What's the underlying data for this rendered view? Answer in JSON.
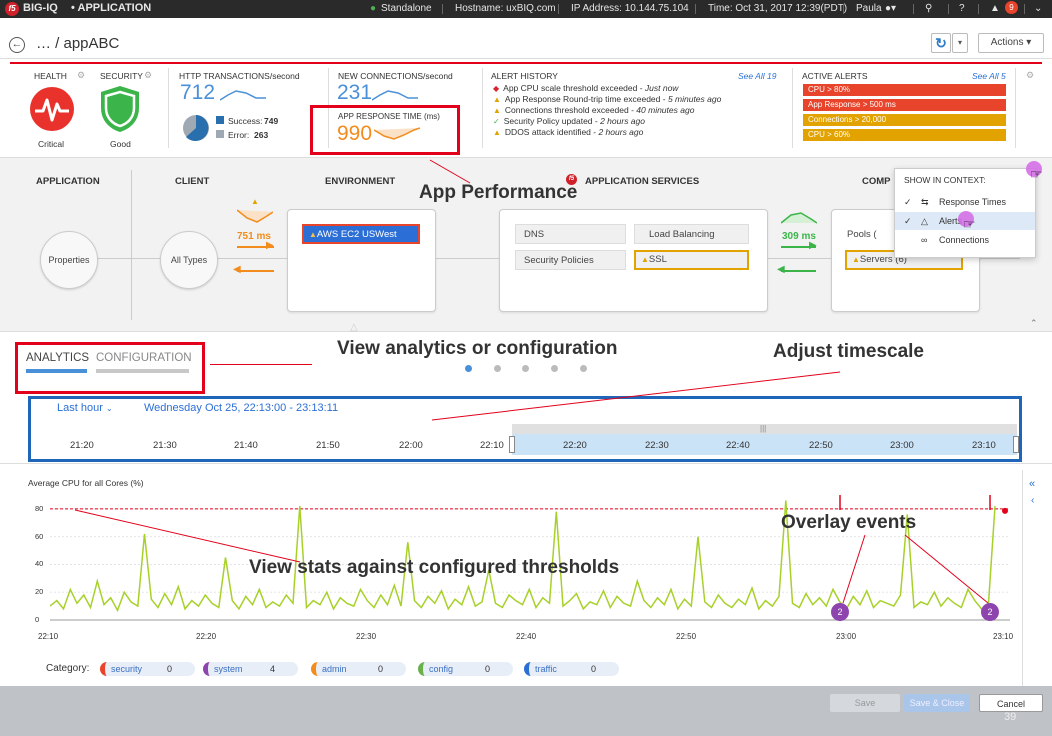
{
  "topbar": {
    "logo_text": "f5",
    "product": "BIG-IQ",
    "module": "• APPLICATION",
    "mode": "Standalone",
    "hostname": "Hostname: uxBIQ.com",
    "ip": "IP Address: 10.144.75.104",
    "time": "Time: Oct 31, 2017 12:39(PDT)",
    "user": "Paula",
    "notifications": "9"
  },
  "header": {
    "breadcrumb": "… / appABC",
    "actions_label": "Actions"
  },
  "dashboard": {
    "health_label": "HEALTH",
    "health_value": "Critical",
    "security_label": "SECURITY",
    "security_value": "Good",
    "http_label": "HTTP TRANSACTIONS/second",
    "http_value": "712",
    "success_label": "Success:",
    "success_value": "749",
    "error_label": "Error:",
    "error_value": "263",
    "conn_label": "NEW CONNECTIONS/second",
    "conn_value": "231",
    "resp_label": "APP RESPONSE TIME (ms)",
    "resp_value": "990",
    "alert_history_label": "ALERT HISTORY",
    "alert_history_link": "See All 19",
    "alert_history": [
      {
        "text": "App CPU scale threshold exceeded - ",
        "time": "Just now",
        "color": "#d9232d"
      },
      {
        "text": "App Response Round-trip time exceeded - ",
        "time": "5 minutes ago",
        "color": "#e2a300"
      },
      {
        "text": "Connections threshold exceeded - ",
        "time": "40 minutes ago",
        "color": "#e2a300"
      },
      {
        "text": "Security Policy updated - ",
        "time": "2 hours ago",
        "color": "#4caf50"
      },
      {
        "text": "DDOS attack identified - ",
        "time": "2 hours ago",
        "color": "#e2a300"
      }
    ],
    "active_alerts_label": "ACTIVE ALERTS",
    "active_alerts_link": "See All 5",
    "active_alerts": [
      {
        "text": "CPU > 80%",
        "color": "#e8442b"
      },
      {
        "text": "App Response > 500 ms",
        "color": "#e8442b"
      },
      {
        "text": "Connections > 20,000",
        "color": "#e2a300"
      },
      {
        "text": "CPU > 60%",
        "color": "#e2a300"
      }
    ]
  },
  "topology": {
    "col_application": "APPLICATION",
    "col_client": "CLIENT",
    "col_environment": "ENVIRONMENT",
    "col_services": "APPLICATION SERVICES",
    "col_comp": "COMP",
    "properties": "Properties",
    "all_types": "All Types",
    "client_latency": "751 ms",
    "env_chip": "AWS EC2 USWest",
    "svc_dns": "DNS",
    "svc_lb": "Load Balancing",
    "svc_sec": "Security Policies",
    "svc_ssl": "SSL",
    "server_latency": "309 ms",
    "pools": "Pools (",
    "servers": "Servers (6)"
  },
  "context_menu": {
    "title": "SHOW IN CONTEXT:",
    "items": [
      "Response Times",
      "Alerts",
      "Connections"
    ]
  },
  "annotations": {
    "app_performance": "App Performance",
    "view_analytics": "View analytics or configuration",
    "adjust_timescale": "Adjust timescale",
    "overlay_events": "Overlay events",
    "view_stats": "View stats against configured thresholds"
  },
  "tabs": {
    "analytics": "ANALYTICS",
    "configuration": "CONFIGURATION"
  },
  "timescale": {
    "range_select": "Last hour",
    "range_text": "Wednesday Oct 25, 22:13:00 - 23:13:11",
    "ticks": [
      "21:20",
      "21:30",
      "21:40",
      "21:50",
      "22:00",
      "22:10",
      "22:20",
      "22:30",
      "22:40",
      "22:50",
      "23:00",
      "23:10"
    ]
  },
  "chart_data": {
    "type": "line",
    "title": "Average CPU for all Cores (%)",
    "ylim": [
      0,
      90
    ],
    "yticks": [
      "0",
      "20",
      "40",
      "60",
      "80"
    ],
    "xticks": [
      "22:10",
      "22:20",
      "22:30",
      "22:40",
      "22:50",
      "23:00",
      "23:10"
    ],
    "threshold": 80,
    "series_color": "#a7d129",
    "values": [
      10,
      14,
      8,
      22,
      12,
      18,
      9,
      28,
      11,
      16,
      7,
      20,
      13,
      10,
      62,
      15,
      9,
      19,
      11,
      24,
      8,
      14,
      10,
      18,
      12,
      9,
      45,
      14,
      8,
      17,
      11,
      22,
      9,
      13,
      10,
      18,
      12,
      82,
      9,
      14,
      11,
      20,
      8,
      16,
      12,
      10,
      22,
      14,
      9,
      18,
      11,
      25,
      10,
      56,
      14,
      9,
      17,
      12,
      21,
      8,
      15,
      11,
      24,
      10,
      13,
      36,
      12,
      9,
      18,
      14,
      11,
      22,
      9,
      16,
      12,
      78,
      10,
      14,
      19,
      8,
      13,
      11,
      21,
      9,
      17,
      12,
      10,
      28,
      14,
      9,
      16,
      11,
      22,
      8,
      15,
      10,
      60,
      13,
      9,
      18,
      12,
      9,
      15,
      11,
      23,
      8,
      14,
      10,
      17,
      86,
      12,
      9,
      19,
      11,
      16,
      10,
      22,
      13,
      8,
      17,
      11,
      21,
      9,
      14,
      12,
      10,
      18,
      76,
      9,
      13,
      11,
      20,
      10,
      16,
      12,
      9,
      22,
      14,
      8,
      10,
      82
    ],
    "events": [
      {
        "x": "23:00",
        "count": "2"
      },
      {
        "x": "23:10",
        "count": "2"
      }
    ]
  },
  "categories": {
    "label": "Category:",
    "items": [
      {
        "name": "security",
        "count": "0",
        "color": "#e8442b"
      },
      {
        "name": "system",
        "count": "4",
        "color": "#8e44ad"
      },
      {
        "name": "admin",
        "count": "0",
        "color": "#f28c1c"
      },
      {
        "name": "config",
        "count": "0",
        "color": "#6ab04c"
      },
      {
        "name": "traffic",
        "count": "0",
        "color": "#2b6fd6"
      }
    ]
  },
  "footer": {
    "save": "Save",
    "save_close": "Save & Close",
    "cancel": "Cancel",
    "page_number": "39"
  }
}
